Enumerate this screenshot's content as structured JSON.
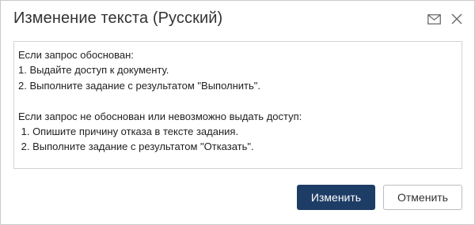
{
  "dialog": {
    "title": "Изменение текста (Русский)",
    "icons": {
      "mail": "mail-icon",
      "close": "close-icon"
    }
  },
  "editor": {
    "value": "Если запрос обоснован:\n1. Выдайте доступ к документу.\n2. Выполните задание с результатом \"Выполнить\".\n\nЕсли запрос не обоснован или невозможно выдать доступ:\n 1. Опишите причину отказа в тексте задания.\n 2. Выполните задание с результатом \"Отказать\"."
  },
  "buttons": {
    "apply_label": "Изменить",
    "cancel_label": "Отменить"
  },
  "colors": {
    "primary": "#1e3d66",
    "border": "#c9c9c9",
    "icon": "#6b6b6b"
  }
}
